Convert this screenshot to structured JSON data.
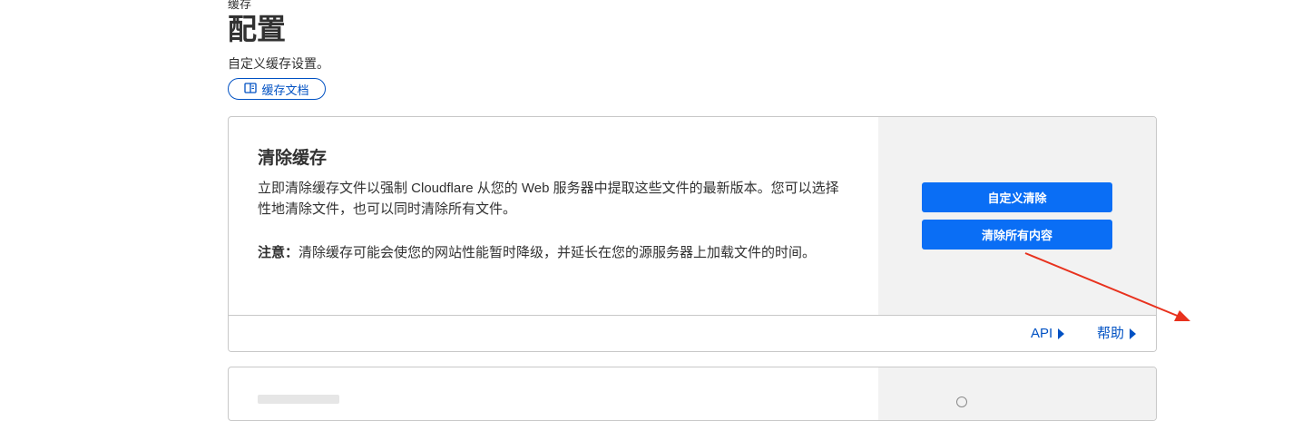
{
  "breadcrumb": "缓存",
  "page": {
    "title": "配置",
    "subtitle": "自定义缓存设置。",
    "docs_button_label": "缓存文档",
    "docs_icon": "book-icon"
  },
  "purge_card": {
    "title": "清除缓存",
    "description": "立即清除缓存文件以强制 Cloudflare 从您的 Web 服务器中提取这些文件的最新版本。您可以选择性地清除文件，也可以同时清除所有文件。",
    "note_label": "注意：",
    "note_text": "清除缓存可能会使您的网站性能暂时降级，并延长在您的源服务器上加载文件的时间。",
    "custom_purge_label": "自定义清除",
    "purge_all_label": "清除所有内容",
    "footer": {
      "api_label": "API",
      "help_label": "帮助"
    }
  },
  "colors": {
    "primary_button": "#0a6ef5",
    "link": "#0051c3",
    "annotation_arrow": "#e8321e",
    "side_panel": "#f2f2f2"
  }
}
